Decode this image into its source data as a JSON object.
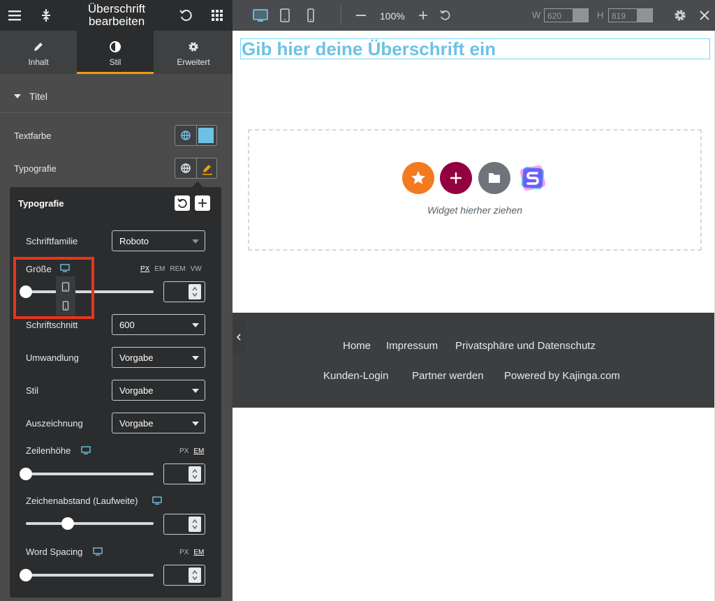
{
  "panel": {
    "title": "Überschrift bearbeiten",
    "tabs": [
      {
        "label": "Inhalt",
        "icon": "pencil-icon"
      },
      {
        "label": "Stil",
        "icon": "half-circle-icon"
      },
      {
        "label": "Erweitert",
        "icon": "gear-icon"
      }
    ],
    "active_tab": "Stil",
    "section": {
      "title": "Titel"
    },
    "controls": {
      "text_color_label": "Textfarbe",
      "text_color_value": "#6ec1e4",
      "typography_label": "Typografie"
    }
  },
  "typography_popover": {
    "title": "Typografie",
    "font_family": {
      "label": "Schriftfamilie",
      "value": "Roboto"
    },
    "size": {
      "label": "Größe",
      "units": [
        "PX",
        "EM",
        "REM",
        "VW"
      ],
      "active_unit": "PX",
      "value": 0
    },
    "weight": {
      "label": "Schriftschnitt",
      "value": "600"
    },
    "transform": {
      "label": "Umwandlung",
      "value": "Vorgabe"
    },
    "style": {
      "label": "Stil",
      "value": "Vorgabe"
    },
    "decoration": {
      "label": "Auszeichnung",
      "value": "Vorgabe"
    },
    "line_height": {
      "label": "Zeilenhöhe",
      "units": [
        "PX",
        "EM"
      ],
      "active_unit": "EM",
      "value": 0
    },
    "letter_spacing": {
      "label": "Zeichenabstand (Laufweite)",
      "value": 0.33
    },
    "word_spacing": {
      "label": "Word Spacing",
      "units": [
        "PX",
        "EM"
      ],
      "active_unit": "EM",
      "value": 0
    }
  },
  "toolbar": {
    "zoom": "100%",
    "width_label": "W",
    "width_value": "620",
    "height_label": "H",
    "height_value": "819"
  },
  "canvas": {
    "heading": "Gib hier deine Überschrift ein",
    "drop_text": "Widget hierher ziehen"
  },
  "footer": {
    "row1": [
      "Home",
      "Impressum",
      "Privatsphäre und Datenschutz"
    ],
    "row2": [
      "Kunden-Login",
      "Partner werden",
      "Powered by Kajinga.com"
    ]
  },
  "colors": {
    "accent": "#f39c12",
    "highlight": "#e5361d",
    "heading": "#6ec1e4",
    "btn_orange": "#f47a1f",
    "btn_plum": "#93003f",
    "btn_gray": "#6f747a"
  }
}
